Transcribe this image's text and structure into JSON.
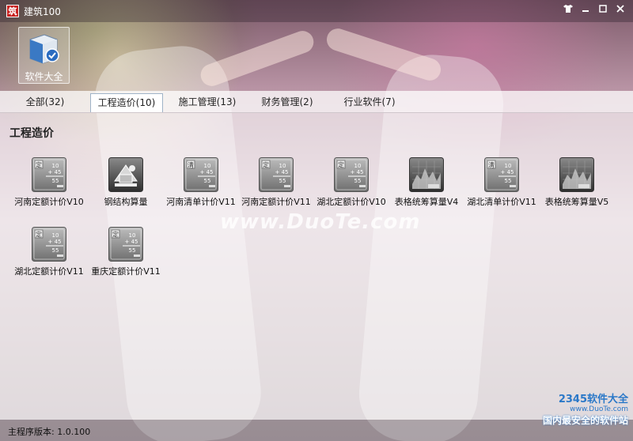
{
  "window": {
    "title": "建筑100",
    "logo_char": "筑",
    "controls": [
      "skin",
      "minimize",
      "maximize",
      "close"
    ]
  },
  "main_tile": {
    "label": "软件大全",
    "icon": "software-box-icon"
  },
  "tabs": [
    {
      "label": "全部(32)",
      "active": false
    },
    {
      "label": "工程造价(10)",
      "active": true
    },
    {
      "label": "施工管理(13)",
      "active": false
    },
    {
      "label": "财务管理(2)",
      "active": false
    },
    {
      "label": "行业软件(7)",
      "active": false
    }
  ],
  "section_title": "工程造价",
  "apps": [
    {
      "label": "河南定额计价V10",
      "icon": "quota-calculator-icon",
      "badge": "定"
    },
    {
      "label": "钢结构算量",
      "icon": "steel-structure-icon",
      "badge": ""
    },
    {
      "label": "河南清单计价V11",
      "icon": "bill-calculator-icon",
      "badge": "清"
    },
    {
      "label": "河南定额计价V11",
      "icon": "quota-calculator-icon",
      "badge": "定"
    },
    {
      "label": "湖北定额计价V10",
      "icon": "quota-calculator-icon",
      "badge": "定"
    },
    {
      "label": "表格统筹算量V4",
      "icon": "chart-table-icon",
      "badge": ""
    },
    {
      "label": "湖北清单计价V11",
      "icon": "bill-calculator-icon",
      "badge": "清"
    },
    {
      "label": "表格统筹算量V5",
      "icon": "chart-table-icon",
      "badge": ""
    },
    {
      "label": "湖北定额计价V11",
      "icon": "quota-calculator-icon",
      "badge": "定"
    },
    {
      "label": "重庆定额计价V11",
      "icon": "quota-calculator-icon",
      "badge": "定"
    }
  ],
  "calc_icon_digits": {
    "a": "10",
    "b": "+ 45",
    "c": "55"
  },
  "status": {
    "version_text": "主程序版本: 1.0.100"
  },
  "watermarks": {
    "center": "www.DuoTe.com",
    "corner_brand": "2345软件大全",
    "corner_url": "www.DuoTe.com",
    "corner_slogan": "国内最安全的软件站"
  },
  "colors": {
    "tab_active_border": "#9fb3c7",
    "logo_red": "#c8201e"
  }
}
